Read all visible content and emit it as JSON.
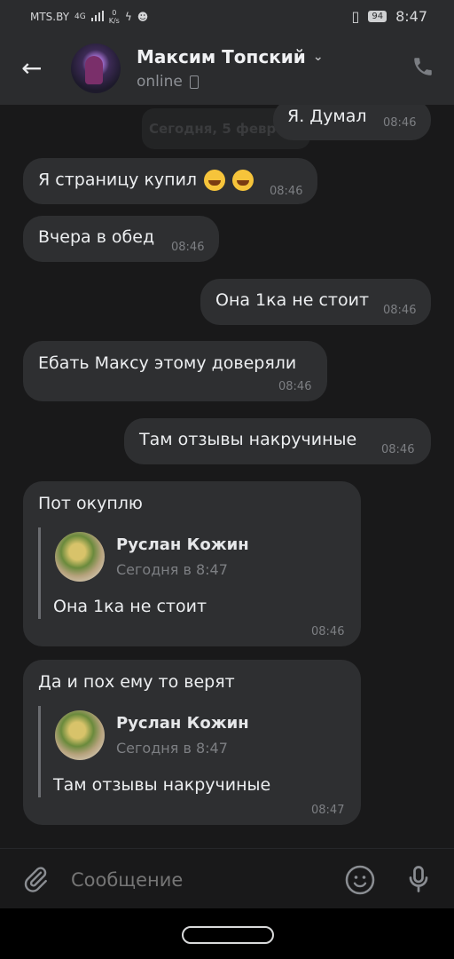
{
  "status": {
    "carrier": "MTS.BY",
    "network": "4G",
    "speed": "0",
    "speed_unit": "K/s",
    "battery": "94",
    "time": "8:47"
  },
  "header": {
    "back_label": "←",
    "name": "Максим Топский",
    "chevron": "⌄",
    "status": "online"
  },
  "chat": {
    "date_separator": "Сегодня, 5 февраля",
    "messages": [
      {
        "text": "Я. Думал",
        "time": "08:46"
      },
      {
        "text": "Я страницу купил",
        "time": "08:46"
      },
      {
        "text": "Вчера в обед",
        "time": "08:46"
      },
      {
        "text": "Она 1ка не стоит",
        "time": "08:46"
      },
      {
        "text": "Ебать Максу этому доверяли",
        "time": "08:46"
      },
      {
        "text": "Там отзывы накручиные",
        "time": "08:46"
      },
      {
        "text": "Пот окуплю",
        "time": "08:46",
        "reply": {
          "name": "Руслан Кожин",
          "sub": "Сегодня в 8:47",
          "text": "Она 1ка не стоит"
        }
      },
      {
        "text": "Да и пох ему то верят",
        "time": "08:47",
        "reply": {
          "name": "Руслан Кожин",
          "sub": "Сегодня в 8:47",
          "text": "Там отзывы накручиные"
        }
      }
    ]
  },
  "composer": {
    "placeholder": "Сообщение"
  }
}
